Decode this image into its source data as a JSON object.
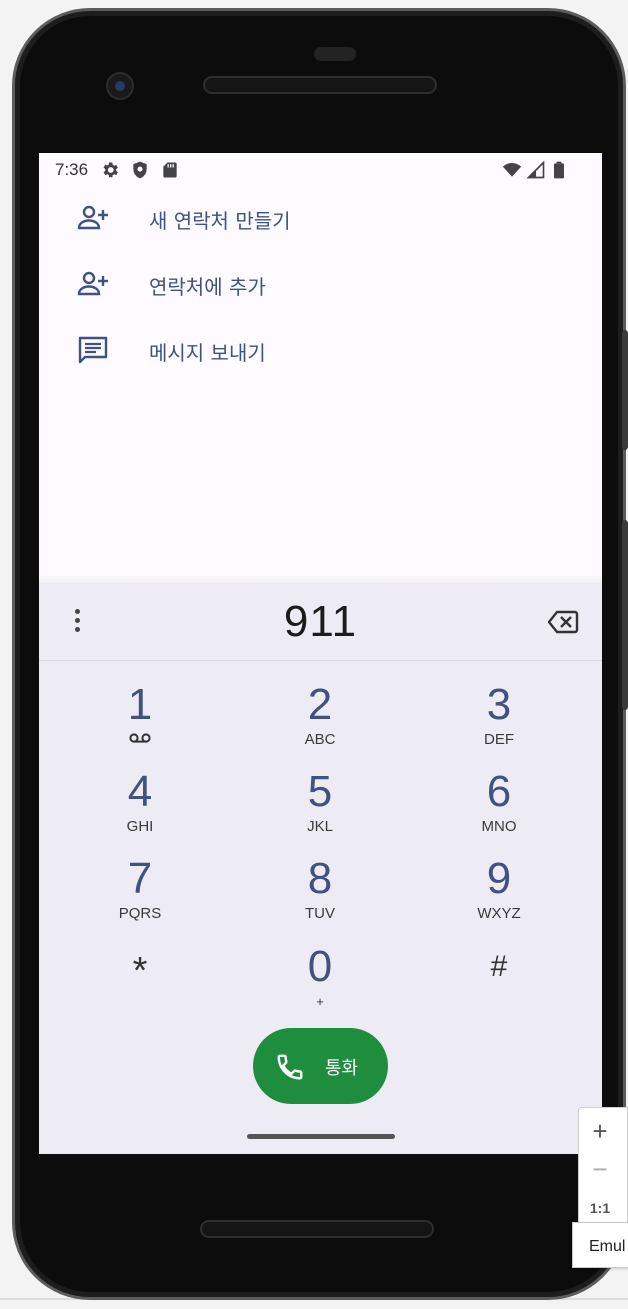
{
  "status_bar": {
    "time": "7:36",
    "left_icons": [
      "gear-icon",
      "shield-icon",
      "sd-card-icon"
    ],
    "right_icons": [
      "wifi-icon",
      "signal-icon",
      "battery-icon"
    ]
  },
  "actions": [
    {
      "icon": "add-person-icon",
      "label": "새 연락처 만들기"
    },
    {
      "icon": "add-person-icon",
      "label": "연락처에 추가"
    },
    {
      "icon": "message-icon",
      "label": "메시지 보내기"
    }
  ],
  "dialpad": {
    "digits": "911",
    "keys": [
      {
        "num": "1",
        "sub": "",
        "sub_icon": "voicemail-icon"
      },
      {
        "num": "2",
        "sub": "ABC"
      },
      {
        "num": "3",
        "sub": "DEF"
      },
      {
        "num": "4",
        "sub": "GHI"
      },
      {
        "num": "5",
        "sub": "JKL"
      },
      {
        "num": "6",
        "sub": "MNO"
      },
      {
        "num": "7",
        "sub": "PQRS"
      },
      {
        "num": "8",
        "sub": "TUV"
      },
      {
        "num": "9",
        "sub": "WXYZ"
      },
      {
        "num": "*",
        "sub": ""
      },
      {
        "num": "0",
        "sub": "+"
      },
      {
        "num": "#",
        "sub": ""
      }
    ],
    "call_label": "통화"
  },
  "emulator_controls": {
    "zoom_in": "+",
    "zoom_out": "−",
    "actual_size": "1:1",
    "tooltip": "Emul"
  },
  "colors": {
    "accent": "#3f5282",
    "call_green": "#1e8e3e",
    "screen_bg": "#fdfbff",
    "dialpad_bg": "#edecf4"
  }
}
